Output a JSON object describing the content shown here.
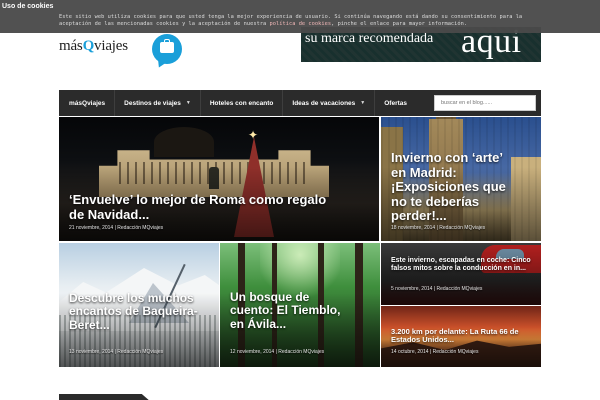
{
  "cookie": {
    "title": "Uso de cookies",
    "text_before": "Este sitio web utiliza cookies para que usted tenga la mejor experiencia de usuario. Si continúa navegando está dando su consentimiento para la aceptación de las mencionadas cookies y la aceptación de nuestra ",
    "link": "política de cookies",
    "text_after": ", pinche el enlace para mayor información."
  },
  "logo": {
    "pre": "más",
    "q": "Q",
    "post": "viajes"
  },
  "banner": {
    "left": "su marca recomendada",
    "right": "aqui"
  },
  "nav": {
    "items": [
      {
        "label": "másQviajes",
        "arrow": ""
      },
      {
        "label": "Destinos de viajes",
        "arrow": "▼"
      },
      {
        "label": "Hoteles con encanto",
        "arrow": ""
      },
      {
        "label": "Ideas de vacaciones",
        "arrow": "▼"
      },
      {
        "label": "Ofertas",
        "arrow": ""
      }
    ],
    "search_placeholder": "buscar en el blog......"
  },
  "posts": [
    {
      "title": "‘Envuelve’ lo mejor de Roma como regalo de Navidad...",
      "date": "21 noviembre, 2014",
      "author": "Redacción MQviajes"
    },
    {
      "title": "Invierno con ‘arte’ en Madrid: ¡Exposiciones que no te deberías perder!...",
      "date": "18 noviembre, 2014",
      "author": "Redacción MQviajes"
    },
    {
      "title": "Descubre los muchos encantos de Baqueira-Beret...",
      "date": "13 noviembre, 2014",
      "author": "Redacción MQviajes"
    },
    {
      "title": "Un bosque de cuento: El Tiemblo, en Ávila...",
      "date": "12 noviembre, 2014",
      "author": "Redacción MQviajes"
    },
    {
      "title": "Este invierno, escapadas en coche: Cinco falsos mitos sobre la conducción en in...",
      "date": "5 noviembre, 2014",
      "author": "Redacción MQviajes"
    },
    {
      "title": "3.200 km por delante: La Ruta 66 de Estados Unidos...",
      "date": "14 octubre, 2014",
      "author": "Redacción MQviajes"
    }
  ],
  "meta_separator": " | ",
  "colors": {
    "brand": "#1a9fd9",
    "nav_bg": "#2b2b2b",
    "cookie_link": "#f2b6b6"
  }
}
